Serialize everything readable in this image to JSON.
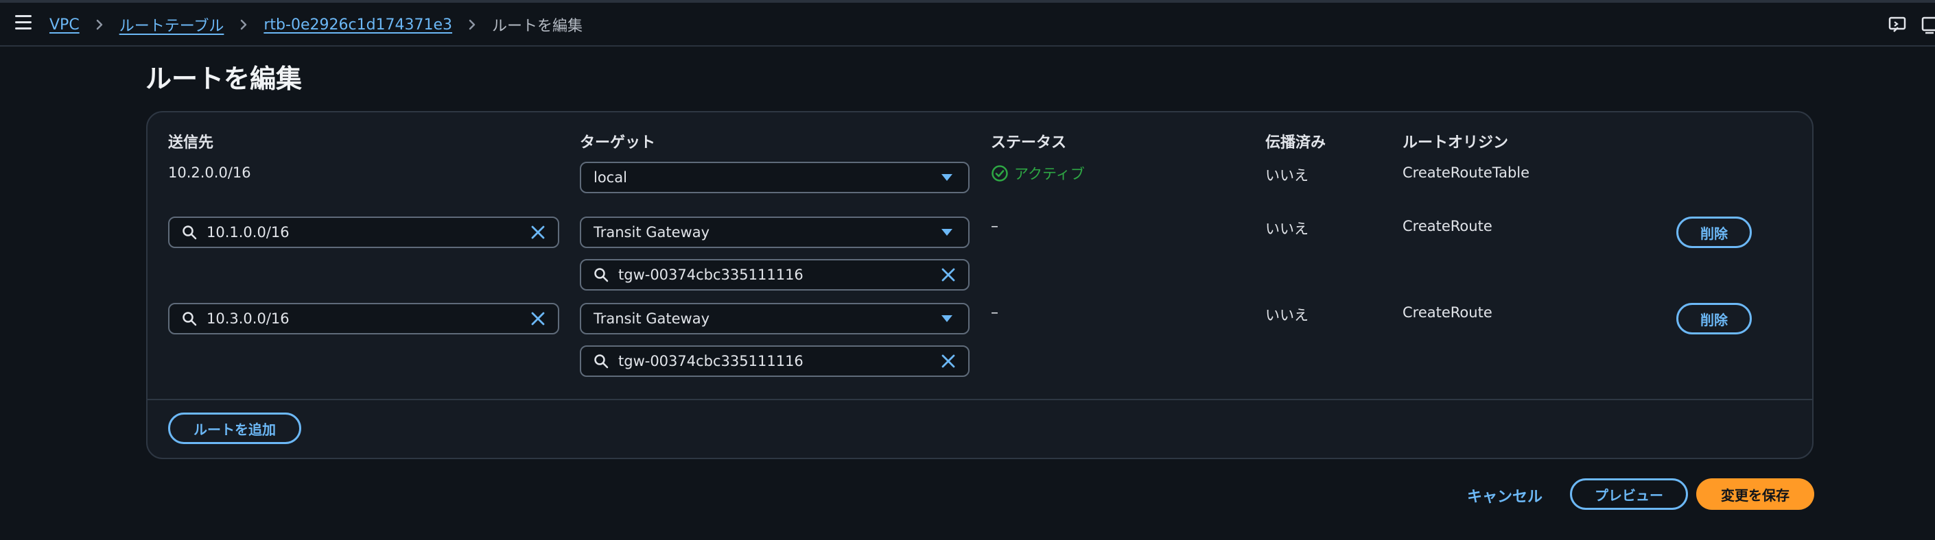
{
  "breadcrumb": {
    "items": [
      "VPC",
      "ルートテーブル",
      "rtb-0e2926c1d174371e3"
    ],
    "current": "ルートを編集"
  },
  "page": {
    "title": "ルートを編集"
  },
  "table": {
    "headers": {
      "destination": "送信先",
      "target": "ターゲット",
      "status": "ステータス",
      "propagated": "伝播済み",
      "origin": "ルートオリジン"
    },
    "rows": [
      {
        "destination": "10.2.0.0/16",
        "target": "local",
        "status": "アクティブ",
        "propagated": "いいえ",
        "origin": "CreateRouteTable"
      },
      {
        "destination": "10.1.0.0/16",
        "target": "Transit Gateway",
        "target_id": "tgw-00374cbc335111116",
        "status": "–",
        "propagated": "いいえ",
        "origin": "CreateRoute",
        "remove_label": "削除"
      },
      {
        "destination": "10.3.0.0/16",
        "target": "Transit Gateway",
        "target_id": "tgw-00374cbc335111116",
        "status": "–",
        "propagated": "いいえ",
        "origin": "CreateRoute",
        "remove_label": "削除"
      }
    ]
  },
  "actions": {
    "add_route": "ルートを追加",
    "cancel": "キャンセル",
    "preview": "プレビュー",
    "save": "変更を保存"
  },
  "colors": {
    "link": "#6cb8f6",
    "primary": "#ff9a26",
    "success": "#2ea844",
    "background": "#0f141a"
  },
  "icons": {
    "menu": "menu-icon",
    "search": "search-icon",
    "clear": "close-icon",
    "dropdown": "caret-down-icon",
    "status": "check-circle-icon"
  }
}
